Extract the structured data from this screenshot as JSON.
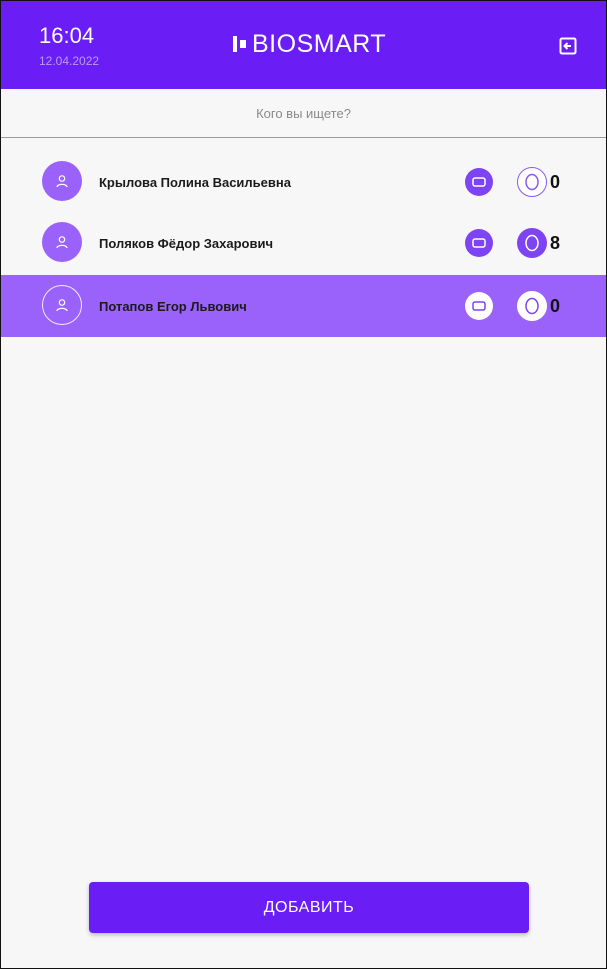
{
  "header": {
    "time": "16:04",
    "date": "12.04.2022",
    "logo_text": "BIOSMART"
  },
  "search": {
    "placeholder": "Кого вы ищете?"
  },
  "users": [
    {
      "name": "Крылова Полина Васильевна",
      "face_count": "0",
      "face_enrolled": false
    },
    {
      "name": "Поляков Фёдор Захарович",
      "face_count": "8",
      "face_enrolled": true
    },
    {
      "name": "Потапов Егор Львович",
      "face_count": "0",
      "face_enrolled": false,
      "selected": true
    }
  ],
  "footer": {
    "add_label": "ДОБАВИТЬ"
  },
  "colors": {
    "primary": "#6a1df5",
    "selected_row": "#9a61fb",
    "accent": "#7e43f3"
  },
  "icons": {
    "exit": "exit-icon",
    "avatar": "user-icon",
    "card": "card-icon",
    "face": "face-icon"
  }
}
